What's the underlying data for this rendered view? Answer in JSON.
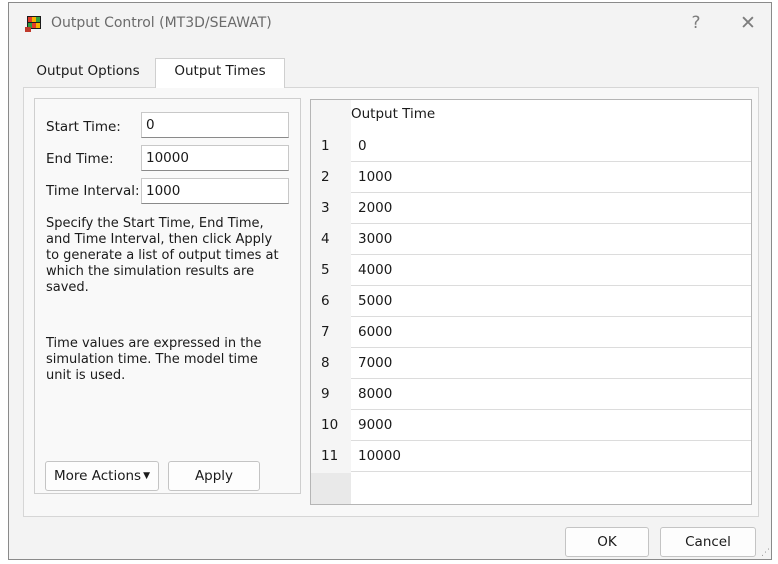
{
  "window": {
    "title": "Output Control (MT3D/SEAWAT)",
    "help_label": "?",
    "close_label": "✕"
  },
  "tabs": [
    {
      "label": "Output Options",
      "active": false
    },
    {
      "label": "Output Times",
      "active": true
    }
  ],
  "fields": {
    "start_time": {
      "label": "Start Time:",
      "value": "0"
    },
    "end_time": {
      "label": "End Time:",
      "value": "10000"
    },
    "time_interval": {
      "label": "Time Interval:",
      "value": "1000"
    }
  },
  "description": {
    "p1": "Specify the Start Time, End Time, and Time Interval, then click Apply to generate a list of output times at which the simulation results are saved.",
    "p2": "Time values are expressed in the simulation time. The model time unit is used."
  },
  "buttons": {
    "more_actions": "More Actions",
    "apply": "Apply",
    "ok": "OK",
    "cancel": "Cancel"
  },
  "table": {
    "column_header": "Output Time",
    "rows": [
      {
        "num": "1",
        "value": "0"
      },
      {
        "num": "2",
        "value": "1000"
      },
      {
        "num": "3",
        "value": "2000"
      },
      {
        "num": "4",
        "value": "3000"
      },
      {
        "num": "5",
        "value": "4000"
      },
      {
        "num": "6",
        "value": "5000"
      },
      {
        "num": "7",
        "value": "6000"
      },
      {
        "num": "8",
        "value": "7000"
      },
      {
        "num": "9",
        "value": "8000"
      },
      {
        "num": "10",
        "value": "9000"
      },
      {
        "num": "11",
        "value": "10000"
      }
    ]
  }
}
